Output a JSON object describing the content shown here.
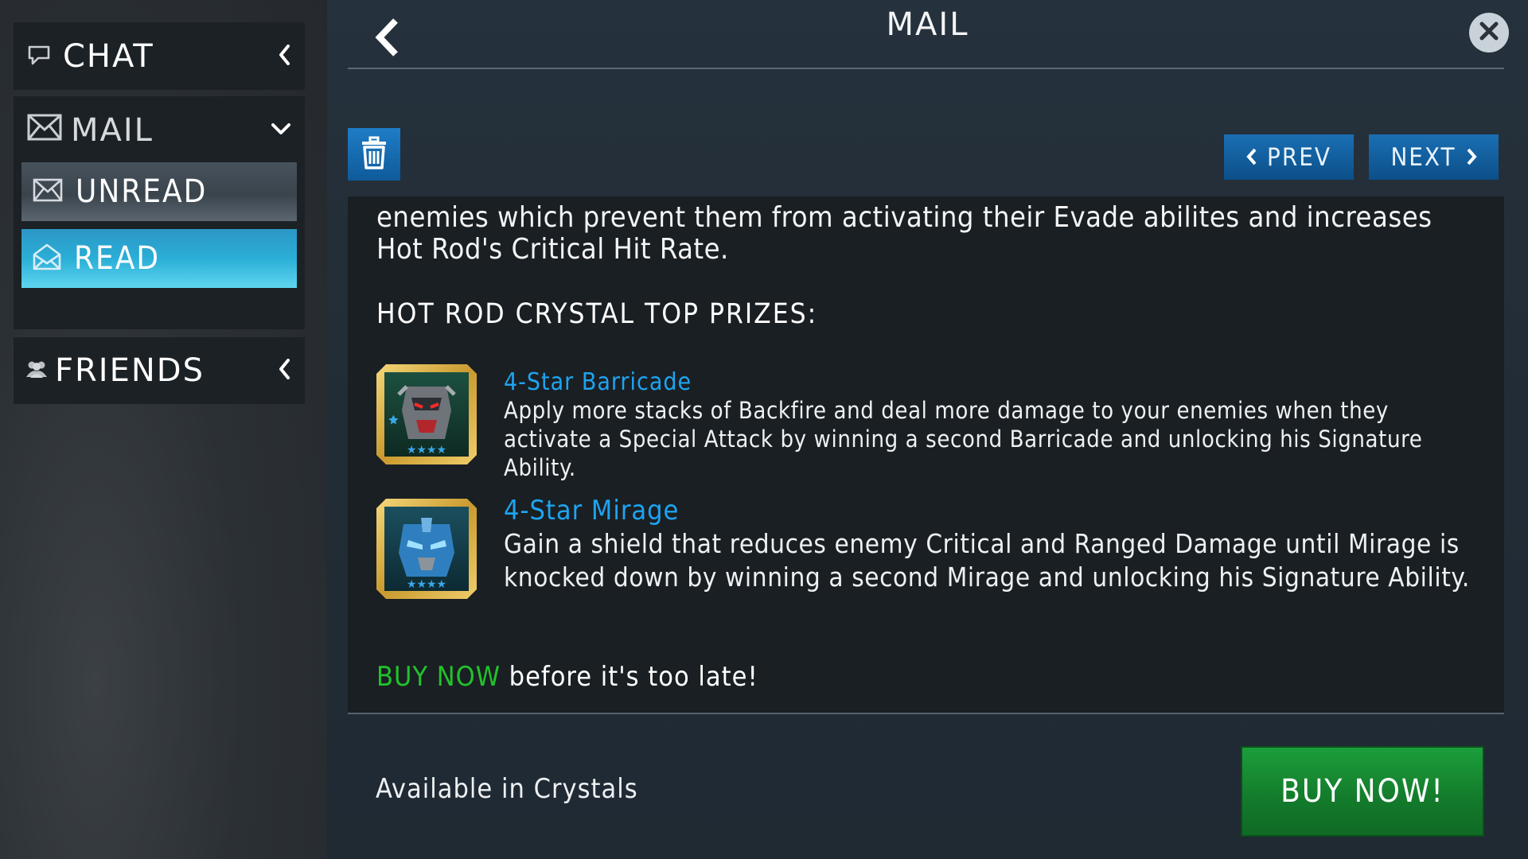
{
  "sidebar": {
    "chat_label": "CHAT",
    "mail_label": "MAIL",
    "unread_label": "UNREAD",
    "read_label": "READ",
    "friends_label": "FRIENDS"
  },
  "header": {
    "title": "MAIL"
  },
  "toolbar": {
    "prev_label": "PREV",
    "next_label": "NEXT"
  },
  "message": {
    "intro_line1": "enemies which prevent them from activating their Evade abilites and increases",
    "intro_line2": "Hot Rod's Critical Hit Rate.",
    "heading": "HOT ROD CRYSTAL TOP PRIZES:",
    "prizes": [
      {
        "name": "4-Star Barricade",
        "desc": "Apply more stacks of Backfire and deal more damage to your enemies when they activate a Special Attack by winning a second Barricade and unlocking his Signature Ability."
      },
      {
        "name": "4-Star Mirage",
        "desc": "Gain a shield that reduces enemy Critical and Ranged Damage until Mirage is knocked down by winning a second Mirage and unlocking his Signature Ability."
      }
    ],
    "buy_link": "BUY NOW",
    "buy_rest": " before it's too late!"
  },
  "footer": {
    "availability": "Available in Crystals",
    "buy_button": "BUY NOW!"
  },
  "colors": {
    "accent_blue": "#1ea4f0",
    "buy_green": "#22c22b",
    "read_tab": "#2aaed6"
  }
}
